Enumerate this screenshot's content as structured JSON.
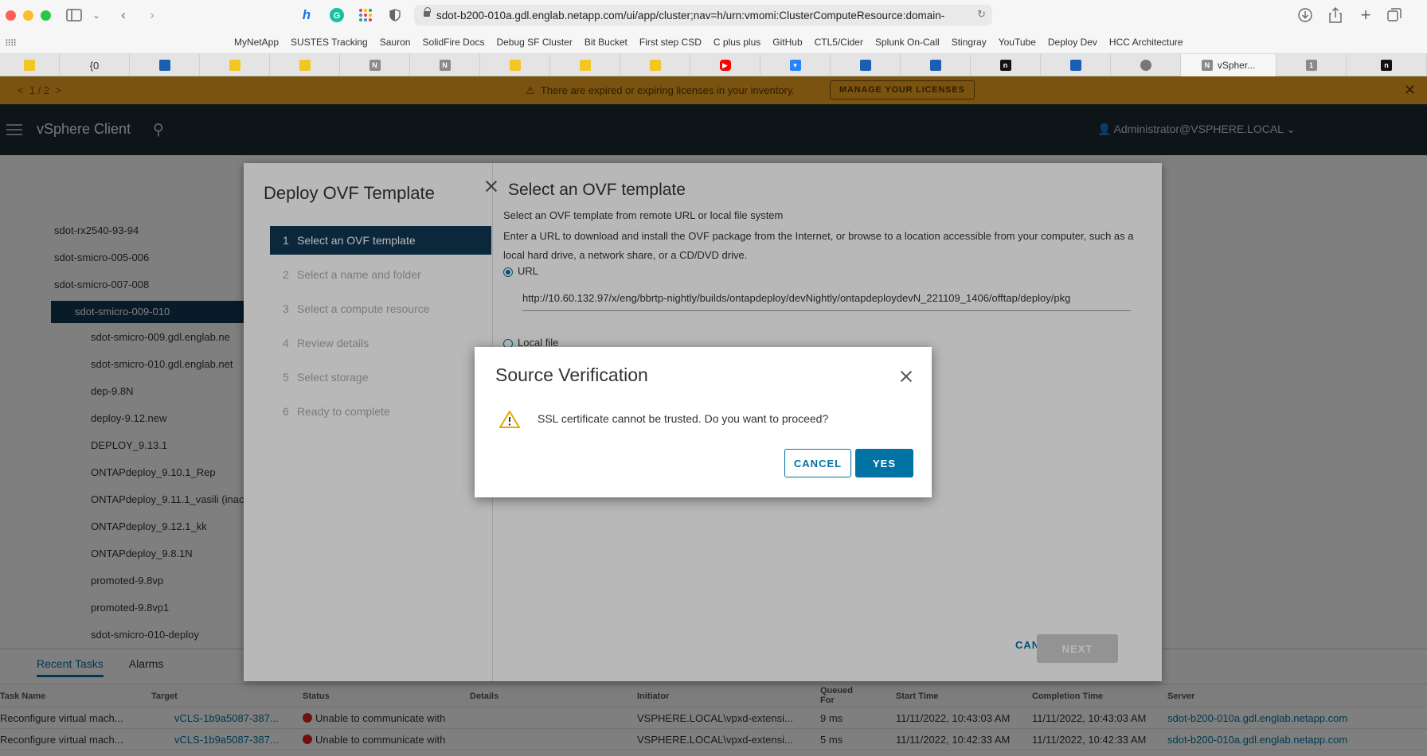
{
  "browser": {
    "address": "sdot-b200-010a.gdl.englab.netapp.com/ui/app/cluster;nav=h/urn:vmomi:ClusterComputeResource:domain-",
    "bookmarks": [
      "MyNetApp",
      "SUSTES Tracking",
      "Sauron",
      "SolidFire Docs",
      "Debug SF Cluster",
      "Bit Bucket",
      "First step CSD",
      "C plus plus",
      "GitHub",
      "CTL5/Cider",
      "Splunk On-Call",
      "Stingray",
      "YouTube",
      "Deploy Dev",
      "HCC Architecture"
    ],
    "tabs": [
      {
        "icon": "sticky-note-icon",
        "label": ""
      },
      {
        "icon": "json-icon",
        "label": "{0"
      },
      {
        "icon": "blue-square-icon",
        "label": ""
      },
      {
        "icon": "sticky-note-icon",
        "label": ""
      },
      {
        "icon": "sticky-note-icon",
        "label": ""
      },
      {
        "icon": "n-icon",
        "label": ""
      },
      {
        "icon": "n-icon",
        "label": ""
      },
      {
        "icon": "sticky-note-icon",
        "label": ""
      },
      {
        "icon": "sticky-note-icon",
        "label": ""
      },
      {
        "icon": "sticky-note-icon",
        "label": ""
      },
      {
        "icon": "youtube-icon",
        "label": ""
      },
      {
        "icon": "bitbucket-icon",
        "label": ""
      },
      {
        "icon": "blue-square-icon",
        "label": ""
      },
      {
        "icon": "blue-square-icon",
        "label": ""
      },
      {
        "icon": "netapp-icon",
        "label": ""
      },
      {
        "icon": "blue-square-icon",
        "label": ""
      },
      {
        "icon": "avatar-icon",
        "label": ""
      },
      {
        "icon": "n-icon",
        "label": "vSpher..."
      },
      {
        "icon": "1-icon",
        "label": ""
      },
      {
        "icon": "netapp-icon",
        "label": ""
      }
    ]
  },
  "banner": {
    "pager": "1 / 2",
    "message": "There are expired or expiring licenses in your inventory.",
    "button": "MANAGE YOUR LICENSES"
  },
  "app": {
    "title": "vSphere Client",
    "user": "Administrator@VSPHERE.LOCAL"
  },
  "tree": [
    {
      "label": "sdot-rx2540-93-94"
    },
    {
      "label": "sdot-smicro-005-006"
    },
    {
      "label": "sdot-smicro-007-008"
    },
    {
      "label": "sdot-smicro-009-010"
    },
    {
      "label": "sdot-smicro-009.gdl.englab.ne"
    },
    {
      "label": "sdot-smicro-010.gdl.englab.net"
    },
    {
      "label": "dep-9.8N"
    },
    {
      "label": "deploy-9.12.new"
    },
    {
      "label": "DEPLOY_9.13.1"
    },
    {
      "label": "ONTAPdeploy_9.10.1_Rep"
    },
    {
      "label": "ONTAPdeploy_9.11.1_vasili (inac"
    },
    {
      "label": "ONTAPdeploy_9.12.1_kk"
    },
    {
      "label": "ONTAPdeploy_9.8.1N"
    },
    {
      "label": "promoted-9.8vp"
    },
    {
      "label": "promoted-9.8vp1"
    },
    {
      "label": "sdot-smicro-010-deploy"
    }
  ],
  "bottom": {
    "tabs": [
      "Recent Tasks",
      "Alarms"
    ],
    "columns": [
      "Task Name",
      "Target",
      "Status",
      "Details",
      "Initiator",
      "Queued For",
      "Start Time",
      "Completion Time",
      "Server"
    ],
    "rows": [
      {
        "task": "Reconfigure virtual mach...",
        "target": "vCLS-1b9a5087-387...",
        "status": "Unable to communicate with",
        "initiator": "VSPHERE.LOCAL\\vpxd-extensi...",
        "queued": "9 ms",
        "start": "11/11/2022, 10:43:03 AM",
        "completion": "11/11/2022, 10:43:03 AM",
        "server": "sdot-b200-010a.gdl.englab.netapp.com"
      },
      {
        "task": "Reconfigure virtual mach...",
        "target": "vCLS-1b9a5087-387...",
        "status": "Unable to communicate with",
        "initiator": "VSPHERE.LOCAL\\vpxd-extensi...",
        "queued": "5 ms",
        "start": "11/11/2022, 10:42:33 AM",
        "completion": "11/11/2022, 10:42:33 AM",
        "server": "sdot-b200-010a.gdl.englab.netapp.com"
      }
    ]
  },
  "wizard": {
    "title": "Deploy OVF Template",
    "steps": [
      {
        "num": "1",
        "label": "Select an OVF template"
      },
      {
        "num": "2",
        "label": "Select a name and folder"
      },
      {
        "num": "3",
        "label": "Select a compute resource"
      },
      {
        "num": "4",
        "label": "Review details"
      },
      {
        "num": "5",
        "label": "Select storage"
      },
      {
        "num": "6",
        "label": "Ready to complete"
      }
    ],
    "heading": "Select an OVF template",
    "subtitle": "Select an OVF template from remote URL or local file system",
    "description": "Enter a URL to download and install the OVF package from the Internet, or browse to a location accessible from your computer, such as a local hard drive, a network share, or a CD/DVD drive.",
    "url_label": "URL",
    "url_value": "http://10.60.132.97/x/eng/bbrtp-nightly/builds/ontapdeploy/devNightly/ontapdeploydevN_221109_1406/offtap/deploy/pkg",
    "local_label": "Local file",
    "cancel": "CANCEL",
    "next": "NEXT"
  },
  "modal": {
    "title": "Source Verification",
    "message": "SSL certificate cannot be trusted. Do you want to proceed?",
    "cancel": "CANCEL",
    "yes": "YES"
  },
  "colors": {
    "primary": "#0072a3",
    "banner": "#f5a623",
    "header": "#1b2a32",
    "active_step": "#0e3752",
    "warning": "#e8a800"
  }
}
